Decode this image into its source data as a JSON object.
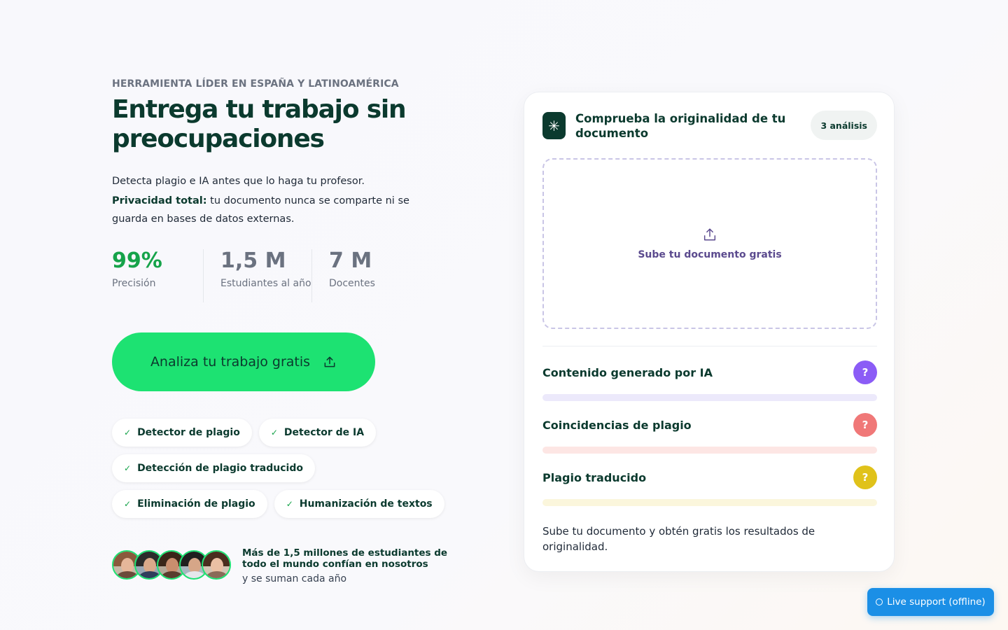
{
  "hero": {
    "eyebrow": "HERRAMIENTA LÍDER EN ESPAÑA Y LATINOAMÉRICA",
    "headline": "Entrega tu trabajo sin preocupaciones",
    "description": "Detecta plagio e IA antes que lo haga tu profesor.",
    "privacy_label": "Privacidad total:",
    "privacy_text": " tu documento nunca se comparte ni se guarda en bases de datos externas."
  },
  "stats": [
    {
      "value": "99%",
      "label": "Precisión"
    },
    {
      "value": "1,5 M",
      "label": "Estudiantes al año"
    },
    {
      "value": "7 M",
      "label": "Docentes"
    }
  ],
  "cta": {
    "label": "Analiza tu trabajo gratis",
    "icon": "upload-icon"
  },
  "features": [
    "Detector de plagio",
    "Detector de IA",
    "Detección de plagio traducido",
    "Eliminación de plagio",
    "Humanización de textos"
  ],
  "social_proof": {
    "headline": "Más de 1,5 millones de estudiantes de todo el mundo confían en nosotros",
    "sub": "y se suman cada año"
  },
  "card": {
    "title": "Comprueba la originalidad de tu documento",
    "badge": "3 análisis",
    "upload_label": "Sube tu documento gratis",
    "metrics": [
      {
        "label": "Contenido generado por IA",
        "value": "?",
        "color": "#8b5cf6",
        "track": "#ece9fb"
      },
      {
        "label": "Coincidencias de plagio",
        "value": "?",
        "color": "#f07878",
        "track": "#fde6e4"
      },
      {
        "label": "Plagio traducido",
        "value": "?",
        "color": "#e0c21a",
        "track": "#fbf6dc"
      }
    ],
    "footer": "Sube tu documento y obtén gratis los resultados de originalidad."
  },
  "support": {
    "label": "Live support (offline)"
  },
  "colors": {
    "accent": "#1de272",
    "brand_dark": "#0b3a2e",
    "support_blue": "#1b8fe6"
  }
}
